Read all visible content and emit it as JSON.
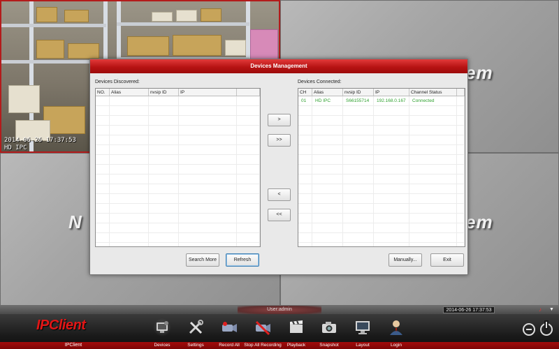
{
  "video_wall": {
    "watermark": "em",
    "watermark_left": "N",
    "camera_timestamp": "2014-06-26 17:37:53",
    "camera_name": "HD IPC"
  },
  "dialog": {
    "title": "Devices Management",
    "discovered_label": "Devices Discovered:",
    "connected_label": "Devices Connected:",
    "discovered_columns": [
      "NO.",
      "Alias",
      "nvsip ID",
      "IP"
    ],
    "connected_columns": [
      "CH",
      "Alias",
      "nvsip ID",
      "IP",
      "Channel Status"
    ],
    "connected_rows": [
      {
        "ch": "01",
        "alias": "HD IPC",
        "nvsip_id": "S66155714",
        "ip": "192.168.0.167",
        "status": "Connected"
      }
    ],
    "buttons": {
      "add": ">",
      "add_all": ">>",
      "remove": "<",
      "remove_all": "<<",
      "search_more": "Search More",
      "refresh": "Refresh",
      "manually": "Manually...",
      "exit": "Exit"
    },
    "status_color": "#2fa12f"
  },
  "statusbar": {
    "user": "User:admin",
    "clock": "2014-06-26 17:37:53"
  },
  "toolbar": {
    "logo": "IPClient",
    "logo_caption": "IPClient",
    "items": [
      {
        "label": "Devices",
        "icon": "devices-icon"
      },
      {
        "label": "Settings",
        "icon": "settings-icon"
      },
      {
        "label": "Record All",
        "icon": "record-all-icon"
      },
      {
        "label": "Stop All Recording",
        "icon": "stop-recording-icon"
      },
      {
        "label": "Playback",
        "icon": "playback-icon"
      },
      {
        "label": "Snapshot",
        "icon": "snapshot-icon"
      },
      {
        "label": "Layout",
        "icon": "layout-icon"
      },
      {
        "label": "Login",
        "icon": "login-icon"
      }
    ],
    "accent_color": "#e21616"
  }
}
